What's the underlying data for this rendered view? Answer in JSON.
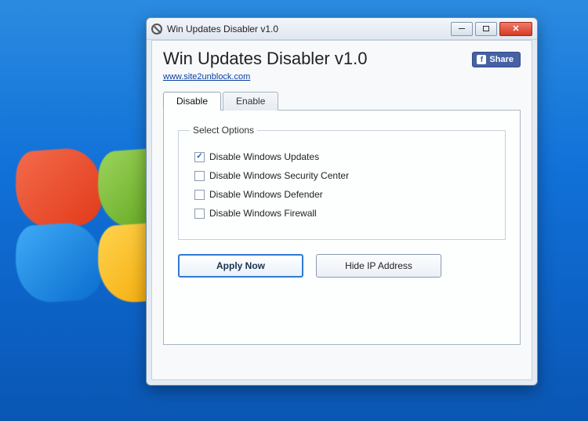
{
  "window": {
    "title": "Win Updates Disabler v1.0"
  },
  "header": {
    "app_title": "Win Updates Disabler v1.0",
    "link_text": "www.site2unblock.com",
    "share_label": "Share"
  },
  "tabs": {
    "items": [
      {
        "label": "Disable",
        "active": true
      },
      {
        "label": "Enable",
        "active": false
      }
    ]
  },
  "group": {
    "legend": "Select Options",
    "options": [
      {
        "label": "Disable Windows Updates",
        "checked": true
      },
      {
        "label": "Disable Windows Security Center",
        "checked": false
      },
      {
        "label": "Disable Windows Defender",
        "checked": false
      },
      {
        "label": "Disable Windows Firewall",
        "checked": false
      }
    ]
  },
  "buttons": {
    "apply": "Apply Now",
    "hide_ip": "Hide IP Address"
  }
}
